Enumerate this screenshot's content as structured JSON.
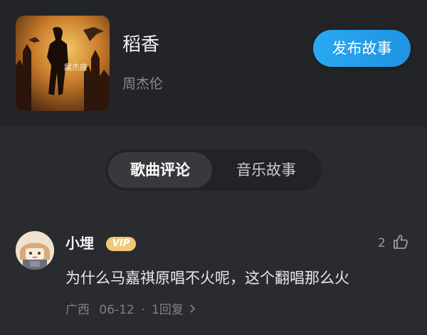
{
  "song": {
    "title": "稻香",
    "artist": "周杰伦",
    "cover_text": "魔杰座"
  },
  "header": {
    "publish_button_label": "发布故事"
  },
  "tabs": [
    {
      "label": "歌曲评论",
      "active": true
    },
    {
      "label": "音乐故事",
      "active": false
    }
  ],
  "comment": {
    "username": "小埋",
    "badge": "VIP",
    "like_count": "2",
    "text": "为什么马嘉祺原唱不火呢，这个翻唱那么火",
    "location": "广西",
    "date": "06-12",
    "separator": "·",
    "replies": "1回复"
  },
  "colors": {
    "background": "#2a2b2f",
    "header_background": "#232427",
    "accent_blue": "#2aa9f2",
    "vip_gold": "#f0c878"
  },
  "icons": {
    "like": "thumbs-up-icon",
    "reply_chevron": "chevron-right-icon"
  }
}
